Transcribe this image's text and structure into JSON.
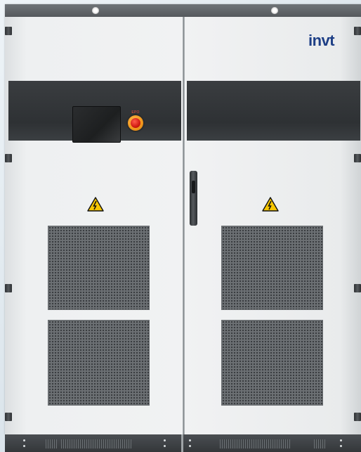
{
  "brand": {
    "logo_text": "invt",
    "logo_color": "#1e3f86",
    "logo_dot_color": "#d9232d"
  },
  "epo_button": {
    "label": "EPO",
    "ring_color": "#f29a1f",
    "button_color": "#d11b12"
  },
  "warning_icons": [
    "high-voltage-warning-icon",
    "high-voltage-warning-icon"
  ],
  "colors": {
    "cabinet_body": "#f1f2f3",
    "dark_band": "#2e3134",
    "vent_mesh": "#3a3d40"
  }
}
